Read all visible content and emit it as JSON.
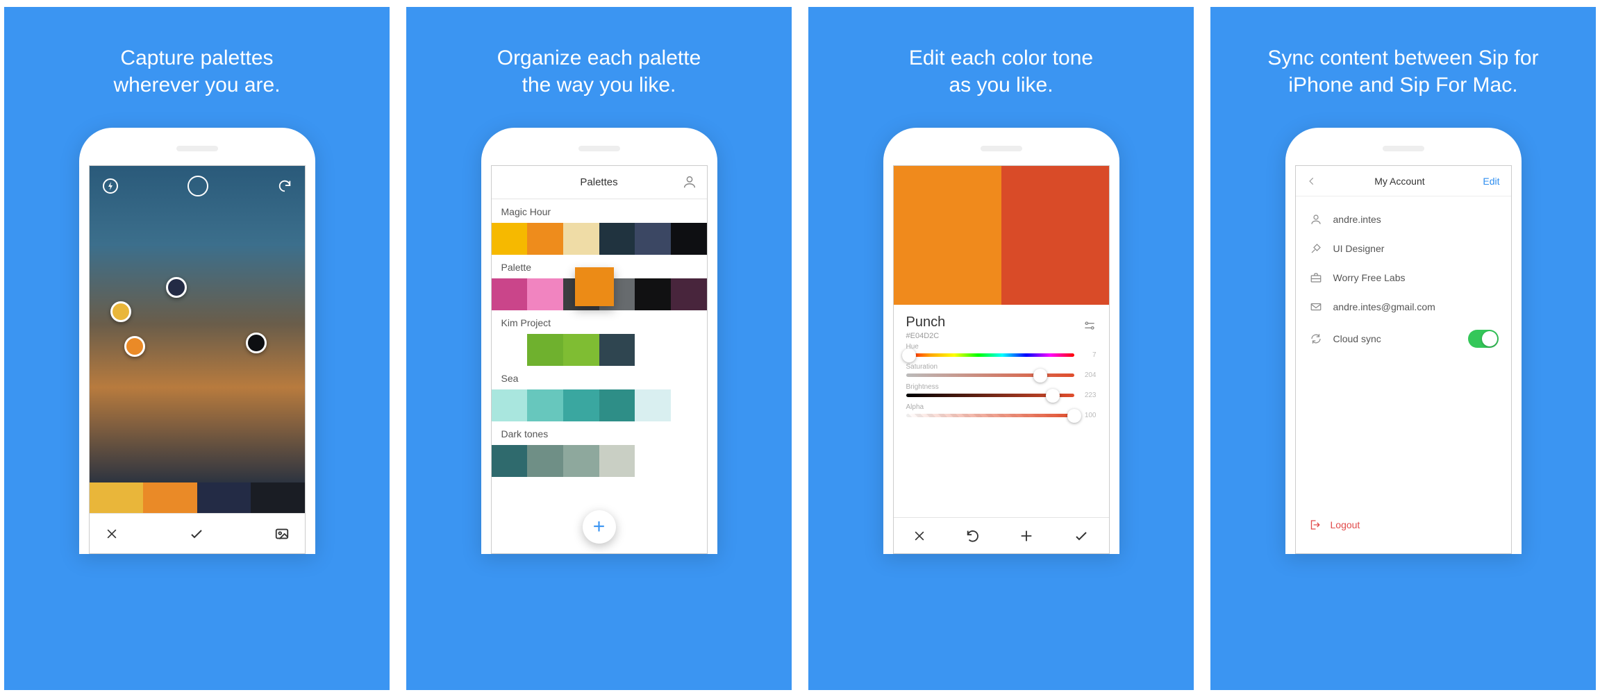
{
  "panels": [
    {
      "caption": "Capture palettes\nwherever you are."
    },
    {
      "caption": "Organize each palette\nthe way you like."
    },
    {
      "caption": "Edit each color tone\nas you like."
    },
    {
      "caption": "Sync content between Sip for\niPhone and Sip For Mac."
    }
  ],
  "capture": {
    "picked_colors": [
      "#e9b63a",
      "#ea8a27",
      "#232b45",
      "#1a1d24",
      "#fefefe"
    ],
    "strip": [
      "#e9b63a",
      "#ea8a27",
      "#232b45",
      "#1a1d24"
    ]
  },
  "organize": {
    "header": "Palettes",
    "palettes": [
      {
        "name": "Magic Hour",
        "colors": [
          "#f6b900",
          "#ee8c1c",
          "#efdca6",
          "#20333f",
          "#3b4763",
          "#0e0f12"
        ]
      },
      {
        "name": "Palette",
        "colors": [
          "#ca458a",
          "#f184c0",
          "#3d3f42",
          "#676b6e",
          "#111112",
          "#48253c"
        ]
      },
      {
        "name": "Kim Project",
        "colors": [
          "#ffffff",
          "#6fb12e",
          "#7fbd33",
          "#2f4550",
          "#ffffff",
          "#ffffff"
        ]
      },
      {
        "name": "Sea",
        "colors": [
          "#a9e6de",
          "#67c7bd",
          "#3aa7a0",
          "#2e8e87",
          "#d9eff0",
          "#ffffff"
        ]
      },
      {
        "name": "Dark tones",
        "colors": [
          "#2f6a6d",
          "#6f8f86",
          "#8ea89d",
          "#c9cfc4",
          "#ffffff",
          "#ffffff"
        ]
      }
    ],
    "drag_chip_color": "#ec8b16"
  },
  "edit": {
    "swatch": [
      "#f08a1c",
      "#d94b28"
    ],
    "name": "Punch",
    "hex": "#E04D2C",
    "sliders": {
      "hue": {
        "label": "Hue",
        "value": 7,
        "max": 360
      },
      "saturation": {
        "label": "Saturation",
        "value": 204,
        "max": 255
      },
      "brightness": {
        "label": "Brightness",
        "value": 223,
        "max": 255
      },
      "alpha": {
        "label": "Alpha",
        "value": 100,
        "max": 100
      }
    }
  },
  "account": {
    "title": "My Account",
    "edit_label": "Edit",
    "username": "andre.intes",
    "role": "UI Designer",
    "company": "Worry Free Labs",
    "email": "andre.intes@gmail.com",
    "cloud_label": "Cloud sync",
    "cloud_on": true,
    "logout_label": "Logout"
  }
}
